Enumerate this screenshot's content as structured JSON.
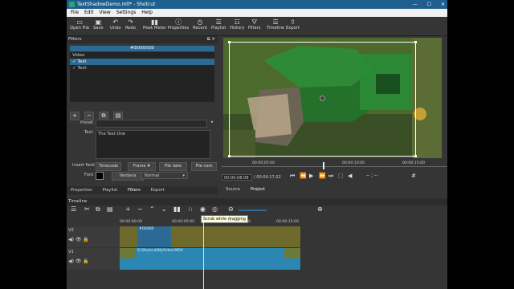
{
  "window": {
    "title": "TextShadowDemo.mlt* - Shotcut"
  },
  "menu": [
    "File",
    "Edit",
    "View",
    "Settings",
    "Help"
  ],
  "toolbar": [
    {
      "icon": "open-file-icon",
      "glyph": "▭",
      "label": "Open File"
    },
    {
      "icon": "save-icon",
      "glyph": "▣",
      "label": "Save"
    },
    {
      "icon": "undo-icon",
      "glyph": "↶",
      "label": "Undo"
    },
    {
      "icon": "redo-icon",
      "glyph": "↷",
      "label": "Redo"
    },
    {
      "icon": "peak-meter-icon",
      "glyph": "▮▮",
      "label": "Peak Meter"
    },
    {
      "icon": "properties-icon",
      "glyph": "ⓘ",
      "label": "Properties"
    },
    {
      "icon": "recent-icon",
      "glyph": "◷",
      "label": "Recent"
    },
    {
      "icon": "playlist-icon",
      "glyph": "☰",
      "label": "Playlist"
    },
    {
      "icon": "history-icon",
      "glyph": "☷",
      "label": "History"
    },
    {
      "icon": "filters-icon",
      "glyph": "⛛",
      "label": "Filters"
    },
    {
      "icon": "timeline-icon",
      "glyph": "☰",
      "label": "Timeline"
    },
    {
      "icon": "export-icon",
      "glyph": "⇪",
      "label": "Export"
    }
  ],
  "filters": {
    "panel_title": "Filters",
    "color_hex": "#00000000",
    "groups": [
      {
        "name": "Video",
        "items": [
          {
            "label": "✓ Text",
            "selected": true
          },
          {
            "label": "✓ Text",
            "selected": false
          }
        ]
      }
    ],
    "preset_label": "Preset",
    "text_label": "Text",
    "text_value": "The Text One",
    "insert_field_label": "Insert field",
    "insert_buttons": [
      "Timecode",
      "Frame #",
      "File date",
      "File nam"
    ],
    "font_label": "Font",
    "font_name": "Verdana",
    "font_weight": "Normal"
  },
  "left_tabs": [
    "Properties",
    "Playlist",
    "Filters",
    "Export"
  ],
  "viewer": {
    "scrub_ticks": [
      "00:00:05:00",
      "00:00:10:00",
      "00:00:15:00"
    ],
    "timecode": "00:00:08:08",
    "duration": "/ 00:00:17:22",
    "tabs": [
      "Source",
      "Project"
    ]
  },
  "timeline": {
    "title": "Timeline",
    "tooltip": "Scrub while dragging",
    "ruler": [
      "00:00:00:00",
      "00:00:05:00",
      "00:00:10:00",
      "00:00:15:00"
    ],
    "tracks": [
      {
        "name": "V2",
        "clip_label": "#00000"
      },
      {
        "name": "V1",
        "clip_label": "S:\\Shotcut\\MyVideo.MOV"
      }
    ]
  },
  "colors": {
    "accent": "#2b6a94",
    "titlebar": "#1e5f8f",
    "track_bg": "#6e6a2c"
  }
}
